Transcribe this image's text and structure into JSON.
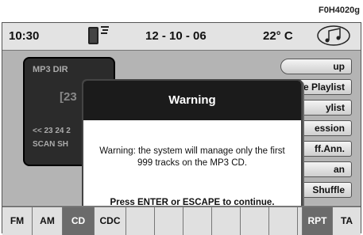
{
  "figure_code": "F0H4020g",
  "status": {
    "time": "10:30",
    "date": "12 - 10 - 06",
    "temperature": "22° C"
  },
  "mp3_panel": {
    "row1": "MP3  DIR",
    "number": "[23",
    "tracks": "<< 23  24  2",
    "row4": "SCAN   SH"
  },
  "menu": [
    {
      "label": "up"
    },
    {
      "label": "e Playlist"
    },
    {
      "label": "ylist"
    },
    {
      "label": "ession"
    },
    {
      "label": "ff.Ann."
    },
    {
      "label": "an"
    },
    {
      "label": "Shuffle"
    }
  ],
  "dialog": {
    "title": "Warning",
    "message": "Warning: the system will manage only the first 999 tracks on the MP3 CD.",
    "footer": "Press ENTER or ESCAPE to continue."
  },
  "bottom_tabs": [
    {
      "label": "FM",
      "active": false
    },
    {
      "label": "AM",
      "active": false
    },
    {
      "label": "CD",
      "active": true
    },
    {
      "label": "CDC",
      "active": false
    },
    {
      "label": "",
      "active": false
    },
    {
      "label": "",
      "active": false
    },
    {
      "label": "",
      "active": false
    },
    {
      "label": "",
      "active": false
    },
    {
      "label": "",
      "active": false
    },
    {
      "label": "",
      "active": false
    },
    {
      "label": "",
      "active": false
    },
    {
      "label": "RPT",
      "active": true
    },
    {
      "label": "TA",
      "active": false
    }
  ],
  "icons": {
    "phone": "phone-icon",
    "signal": "signal-icon",
    "music": "music-note-icon"
  }
}
